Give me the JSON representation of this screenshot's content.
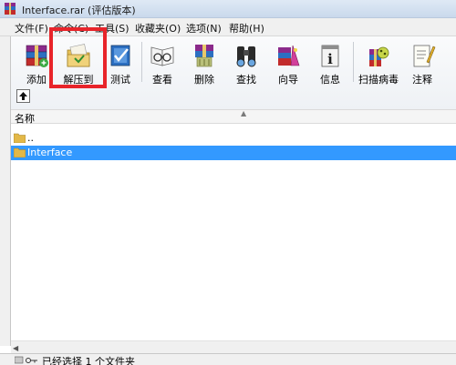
{
  "window": {
    "title": "Interface.rar (评估版本)"
  },
  "menu": [
    "文件(F)",
    "命令(C)",
    "工具(S)",
    "收藏夹(O)",
    "选项(N)",
    "帮助(H)"
  ],
  "toolbar": {
    "buttons": [
      {
        "label": "添加",
        "icon": "add-archive-icon"
      },
      {
        "label": "解压到",
        "icon": "extract-to-icon"
      },
      {
        "label": "测试",
        "icon": "test-icon"
      },
      {
        "label": "查看",
        "icon": "view-icon"
      },
      {
        "label": "删除",
        "icon": "delete-icon"
      },
      {
        "label": "查找",
        "icon": "find-icon"
      },
      {
        "label": "向导",
        "icon": "wizard-icon"
      },
      {
        "label": "信息",
        "icon": "info-icon"
      },
      {
        "label": "扫描病毒",
        "icon": "virus-scan-icon"
      },
      {
        "label": "注释",
        "icon": "comment-icon"
      }
    ],
    "highlight_color": "#e8242a"
  },
  "list": {
    "column_header": "名称",
    "rows": [
      {
        "name": "..",
        "selected": false
      },
      {
        "name": "Interface",
        "selected": true
      }
    ]
  },
  "status": {
    "text": "已经选择 1 个文件夹"
  }
}
